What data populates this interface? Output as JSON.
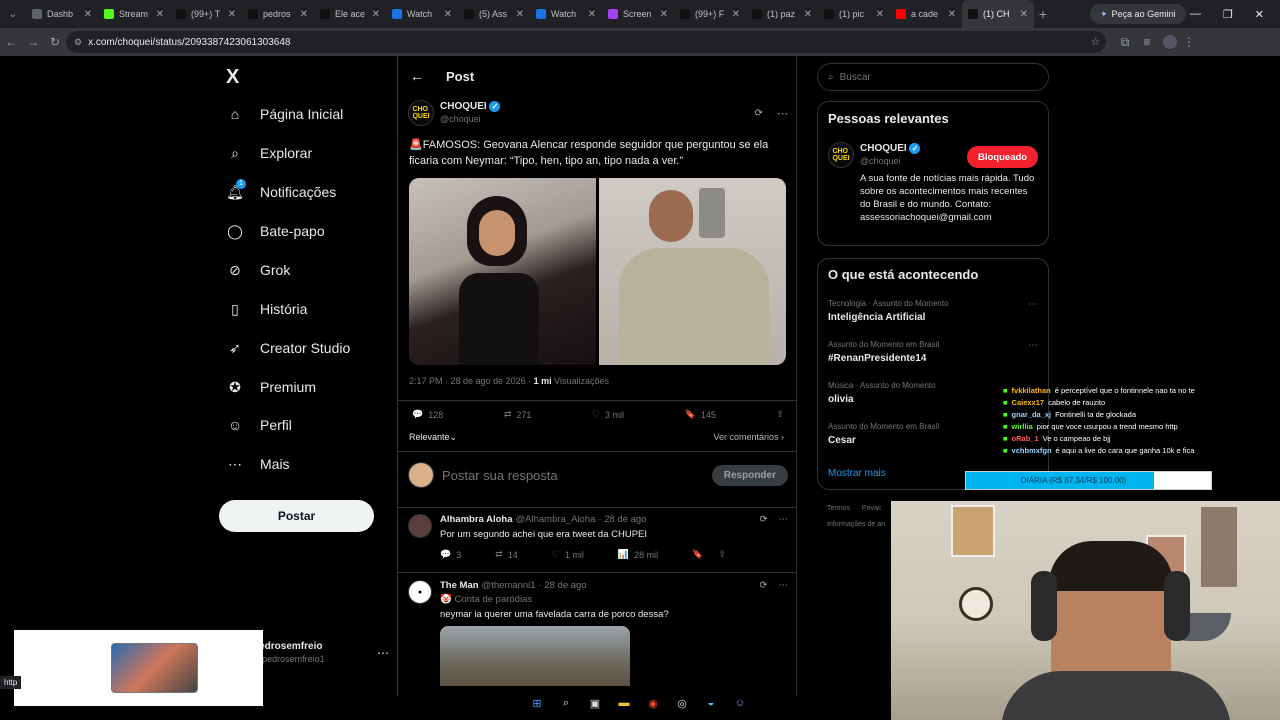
{
  "browser": {
    "tabs": [
      {
        "title": "Dashb",
        "icon": "dashboard-icon",
        "color": "#5f6368"
      },
      {
        "title": "Stream",
        "icon": "kick-icon",
        "color": "#53fc18"
      },
      {
        "title": "(99+) T",
        "icon": "tiktok-icon",
        "color": "#111"
      },
      {
        "title": "pedros",
        "icon": "tiktok-icon",
        "color": "#111"
      },
      {
        "title": "Ele ace",
        "icon": "tiktok-icon",
        "color": "#111"
      },
      {
        "title": "Watch",
        "icon": "watch-icon",
        "color": "#1a73e8"
      },
      {
        "title": "(5) Ass",
        "icon": "x-icon",
        "color": "#111"
      },
      {
        "title": "Watch",
        "icon": "watch-icon",
        "color": "#1a73e8"
      },
      {
        "title": "Screen",
        "icon": "pen-icon",
        "color": "#a142f4"
      },
      {
        "title": "(99+) F",
        "icon": "tiktok-icon",
        "color": "#111"
      },
      {
        "title": "(1) paz",
        "icon": "x-icon",
        "color": "#111"
      },
      {
        "title": "(1) pic",
        "icon": "x-icon",
        "color": "#111"
      },
      {
        "title": "a cade",
        "icon": "youtube-icon",
        "color": "#ff0000"
      },
      {
        "title": "(1) CH",
        "icon": "x-icon",
        "color": "#111"
      }
    ],
    "gemini_label": "Peça ao Gemini",
    "url": "x.com/choquei/status/2093387423061303648"
  },
  "nav": {
    "logo": "X",
    "items": [
      {
        "label": "Página Inicial",
        "icon": "home-icon"
      },
      {
        "label": "Explorar",
        "icon": "search-icon"
      },
      {
        "label": "Notificações",
        "icon": "bell-icon",
        "badge": "1"
      },
      {
        "label": "Bate-papo",
        "icon": "chat-icon"
      },
      {
        "label": "Grok",
        "icon": "grok-icon"
      },
      {
        "label": "História",
        "icon": "bookmark-icon"
      },
      {
        "label": "Creator Studio",
        "icon": "rocket-icon"
      },
      {
        "label": "Premium",
        "icon": "premium-icon"
      },
      {
        "label": "Perfil",
        "icon": "user-icon"
      },
      {
        "label": "Mais",
        "icon": "more-icon"
      }
    ],
    "post_button": "Postar",
    "account": {
      "name": "pedrosemfreio",
      "handle": "@pedrosemfreio1"
    }
  },
  "post": {
    "header": "Post",
    "author": "CHOQUEI",
    "handle": "@choquei",
    "text": "🚨FAMOSOS: Geovana Alencar responde seguidor que perguntou se ela ficaria com Neymar: “Tipo, hen, tipo an, tipo nada a ver.”",
    "time": "2:17 PM · 28 de ago de 2026 · ",
    "views_count": "1 mi",
    "views_label": " Visualizações",
    "stats": {
      "replies": "128",
      "reposts": "271",
      "likes": "3 mil",
      "bookmarks": "145"
    },
    "sort_label": "Relevante",
    "see_comments": "Ver comentários",
    "reply_placeholder": "Postar sua resposta",
    "reply_button": "Responder"
  },
  "replies": [
    {
      "name": "Alhambra Aloha",
      "handle": "@Alhambra_Aloha",
      "date": "· 28 de ago",
      "text": "Por um segundo achei que era tweet da CHUPEI",
      "stats": {
        "replies": "3",
        "reposts": "14",
        "likes": "1 mil",
        "views": "28 mil"
      }
    },
    {
      "name": "The Man",
      "handle": "@themanni1",
      "date": "· 28 de ago",
      "subtitle": "🤡 Conta de paródias",
      "text": "neymar ia querer uma favelada carra de porco dessa?"
    }
  ],
  "right": {
    "search_placeholder": "Buscar",
    "relevant_title": "Pessoas relevantes",
    "person": {
      "name": "CHOQUEI",
      "handle": "@choquei",
      "button": "Bloqueado",
      "bio": "A sua fonte de notícias mais rápida. Tudo sobre os acontecimentos mais recentes do Brasil e do mundo. Contato: assessoriachoquei@gmail.com"
    },
    "trends_title": "O que está acontecendo",
    "trends": [
      {
        "cat": "Tecnologia · Assunto do Momento",
        "name": "Inteligência Artificial"
      },
      {
        "cat": "Assunto do Momento em Brasil",
        "name": "#RenanPresidente14"
      },
      {
        "cat": "Música · Assunto do Momento",
        "name": "olivia"
      },
      {
        "cat": "Assunto do Momento em Brasil",
        "name": "Cesar"
      }
    ],
    "show_more": "Mostrar mais",
    "footer1": "Termos",
    "footer2": "Privac",
    "footer3": "Informações de an"
  },
  "stream_chat": [
    {
      "user": "fvkkilathan",
      "color": "#ffb400",
      "msg": "é perceptível que o fontinnele nao ta no te"
    },
    {
      "user": "Caiexx17",
      "color": "#ffb400",
      "msg": "cabelo de rauzito"
    },
    {
      "user": "gnar_da_xj",
      "color": "#9ad1ff",
      "msg": "Fontinelli ta de glockada"
    },
    {
      "user": "wirllia",
      "color": "#53fc18",
      "msg": "pior que voce usurpou a trend mesmo http"
    },
    {
      "user": "oRab_1",
      "color": "#ff5b5b",
      "msg": "Ve o campeao de bjj"
    },
    {
      "user": "vchbmxfgn",
      "color": "#9ad1ff",
      "msg": "é aqui a live do cara que ganha 10k e fica"
    }
  ],
  "donation_goal": {
    "label": "DIÁRIA (R$ 87,34/R$ 100,00)",
    "progress": 0.8734,
    "color": "#00b4f0"
  },
  "status_url": "http",
  "colors": {
    "accent": "#1d9bf0",
    "block": "#f4212e"
  }
}
